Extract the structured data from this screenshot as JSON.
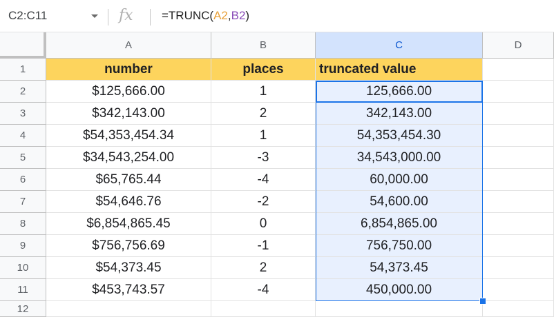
{
  "formula_bar": {
    "name_box": "C2:C11",
    "fx_label": "fx",
    "formula_prefix": "=TRUNC(",
    "formula_ref1": "A2",
    "formula_sep": ",",
    "formula_ref2": "B2",
    "formula_suffix": ")"
  },
  "columns": [
    "A",
    "B",
    "C",
    "D"
  ],
  "selected_column": "C",
  "row_numbers": [
    "1",
    "2",
    "3",
    "4",
    "5",
    "6",
    "7",
    "8",
    "9",
    "10",
    "11",
    "12"
  ],
  "header_row": {
    "a": "number",
    "b": "places",
    "c": "truncated value"
  },
  "rows": [
    {
      "a": "$125,666.00",
      "b": "1",
      "c": "125,666.00"
    },
    {
      "a": "$342,143.00",
      "b": "2",
      "c": "342,143.00"
    },
    {
      "a": "$54,353,454.34",
      "b": "1",
      "c": "54,353,454.30"
    },
    {
      "a": "$34,543,254.00",
      "b": "-3",
      "c": "34,543,000.00"
    },
    {
      "a": "$65,765.44",
      "b": "-4",
      "c": "60,000.00"
    },
    {
      "a": "$54,646.76",
      "b": "-2",
      "c": "54,600.00"
    },
    {
      "a": "$6,854,865.45",
      "b": "0",
      "c": "6,854,865.00"
    },
    {
      "a": "$756,756.69",
      "b": "-1",
      "c": "756,750.00"
    },
    {
      "a": "$54,373.45",
      "b": "2",
      "c": "54,373.45"
    },
    {
      "a": "$453,743.57",
      "b": "-4",
      "c": "450,000.00"
    }
  ],
  "colors": {
    "header_fill": "#fdd45d",
    "selection_fill": "#e8f0fe",
    "selection_border": "#1a73e8"
  },
  "icons": {
    "name_box_dropdown": "chevron-down-icon",
    "function": "fx-icon",
    "fill_handle": "fill-handle-icon"
  }
}
